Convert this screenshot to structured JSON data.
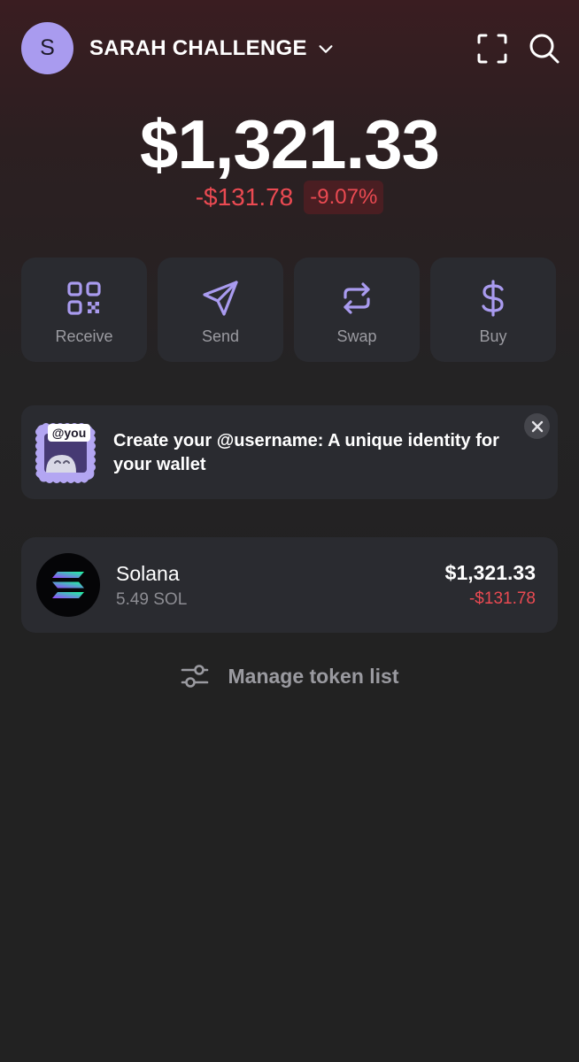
{
  "header": {
    "avatar_letter": "S",
    "account_name": "SARAH CHALLENGE",
    "icons": [
      "chevron-down-icon",
      "scan-icon",
      "search-icon"
    ]
  },
  "balance": {
    "total": "$1,321.33",
    "change_amount": "-$131.78",
    "change_percent": "-9.07%"
  },
  "actions": [
    {
      "label": "Receive",
      "icon": "qr-code-icon"
    },
    {
      "label": "Send",
      "icon": "send-icon"
    },
    {
      "label": "Swap",
      "icon": "swap-icon"
    },
    {
      "label": "Buy",
      "icon": "dollar-icon"
    }
  ],
  "banner": {
    "art_text": "@you",
    "text": "Create your @username: A unique identity for your wallet"
  },
  "tokens": [
    {
      "name": "Solana",
      "amount": "5.49 SOL",
      "value": "$1,321.33",
      "change": "-$131.78"
    }
  ],
  "manage": {
    "label": "Manage token list"
  },
  "colors": {
    "accent": "#a99bef",
    "negative": "#eb4a52",
    "card": "#2a2b30",
    "background": "#222222"
  }
}
